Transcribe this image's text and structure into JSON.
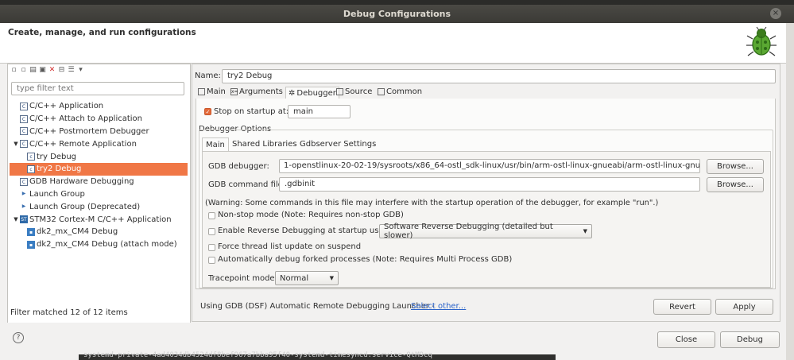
{
  "window": {
    "title": "Debug Configurations"
  },
  "header": {
    "title": "Create, manage, and run configurations"
  },
  "left": {
    "filter_placeholder": "type filter text",
    "tree": [
      {
        "label": "C/C++ Application"
      },
      {
        "label": "C/C++ Attach to Application"
      },
      {
        "label": "C/C++ Postmortem Debugger"
      },
      {
        "label": "C/C++ Remote Application"
      },
      {
        "label": "try Debug"
      },
      {
        "label": "try2 Debug"
      },
      {
        "label": "GDB Hardware Debugging"
      },
      {
        "label": "Launch Group"
      },
      {
        "label": "Launch Group (Deprecated)"
      },
      {
        "label": "STM32 Cortex-M C/C++ Application"
      },
      {
        "label": "dk2_mx_CM4 Debug"
      },
      {
        "label": "dk2_mx_CM4 Debug (attach mode)"
      }
    ],
    "status": "Filter matched 12 of 12 items"
  },
  "right": {
    "name_label": "Name:",
    "name_value": "try2 Debug",
    "tabs": [
      "Main",
      "Arguments",
      "Debugger",
      "Source",
      "Common"
    ],
    "stop_on_startup_label": "Stop on startup at:",
    "stop_on_startup_value": "main",
    "debugger_options_label": "Debugger Options",
    "subtabs": [
      "Main",
      "Shared Libraries",
      "Gdbserver Settings"
    ],
    "gdb_debugger_label": "GDB debugger:",
    "gdb_debugger_value": "1-openstlinux-20-02-19/sysroots/x86_64-ostl_sdk-linux/usr/bin/arm-ostl-linux-gnueabi/arm-ostl-linux-gnueabi-gdb",
    "browse1": "Browse...",
    "gdb_command_label": "GDB command file:",
    "gdb_command_value": ".gdbinit",
    "browse2": "Browse...",
    "warning": "(Warning: Some commands in this file may interfere with the startup operation of the debugger, for example \"run\".)",
    "nonstop": "Non-stop mode (Note: Requires non-stop GDB)",
    "reverse": "Enable Reverse Debugging at startup using:",
    "reverse_option": "Software Reverse Debugging (detailed but slower)",
    "force_thread": "Force thread list update on suspend",
    "auto_forked": "Automatically debug forked processes (Note: Requires Multi Process GDB)",
    "tracepoint_label": "Tracepoint mode:",
    "tracepoint_value": "Normal",
    "launcher_text": "Using GDB (DSF) Automatic Remote Debugging Launcher -",
    "select_other": "Select other...",
    "revert": "Revert",
    "apply": "Apply"
  },
  "footer": {
    "close": "Close",
    "debug": "Debug"
  },
  "background": {
    "bottom_text": "systemd-private-4ad4034db4524df8bef967a7bba95f40-systemd-timesyncd.service-QtM9cq"
  }
}
